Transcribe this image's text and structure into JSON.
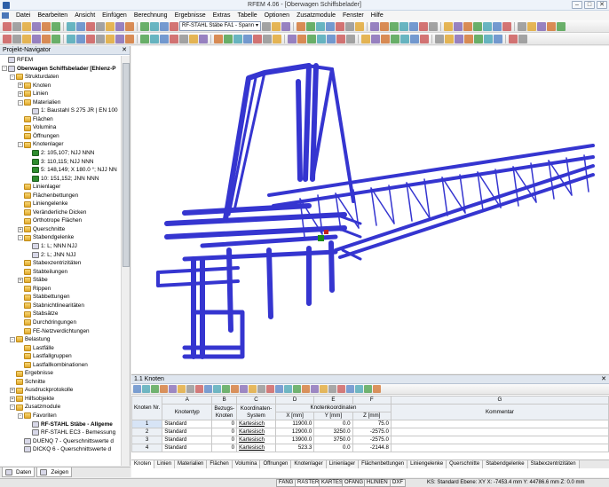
{
  "window": {
    "title": "RFEM 4.06 - [Oberwagen Schiffsbelader]"
  },
  "menu": [
    "Datei",
    "Bearbeiten",
    "Ansicht",
    "Einfügen",
    "Berechnung",
    "Ergebnisse",
    "Extras",
    "Tabelle",
    "Optionen",
    "Zusatzmodule",
    "Fenster",
    "Hilfe"
  ],
  "toolbar": {
    "module_combo": "RF-STAHL Stäbe FA1 - Spann"
  },
  "navigator": {
    "title": "Projekt-Navigator",
    "tree": [
      {
        "label": "RFEM",
        "level": 0,
        "exp": "",
        "icon": "itemico"
      },
      {
        "label": "Oberwagen Schiffsbelader [Ehlenz-P",
        "level": 0,
        "exp": "-",
        "icon": "itemico",
        "bold": true
      },
      {
        "label": "Strukturdaten",
        "level": 1,
        "exp": "-",
        "icon": "folder"
      },
      {
        "label": "Knoten",
        "level": 2,
        "exp": "+",
        "icon": "folder"
      },
      {
        "label": "Linien",
        "level": 2,
        "exp": "+",
        "icon": "folder"
      },
      {
        "label": "Materialien",
        "level": 2,
        "exp": "-",
        "icon": "folder"
      },
      {
        "label": "1: Baustahl S 275 JR | EN 100",
        "level": 3,
        "exp": "",
        "icon": "itemico"
      },
      {
        "label": "Flächen",
        "level": 2,
        "exp": "",
        "icon": "folder"
      },
      {
        "label": "Volumina",
        "level": 2,
        "exp": "",
        "icon": "folder"
      },
      {
        "label": "Öffnungen",
        "level": 2,
        "exp": "",
        "icon": "folder"
      },
      {
        "label": "Knotenlager",
        "level": 2,
        "exp": "-",
        "icon": "folder"
      },
      {
        "label": "2: 105,107; NJJ NNN",
        "level": 3,
        "exp": "",
        "icon": "supico"
      },
      {
        "label": "3: 110,115; NJJ NNN",
        "level": 3,
        "exp": "",
        "icon": "supico"
      },
      {
        "label": "5: 148,149; X 180.0 °; NJJ NN",
        "level": 3,
        "exp": "",
        "icon": "supico"
      },
      {
        "label": "10: 151,152; JNN NNN",
        "level": 3,
        "exp": "",
        "icon": "supico"
      },
      {
        "label": "Linienlager",
        "level": 2,
        "exp": "",
        "icon": "folder"
      },
      {
        "label": "Flächenbettungen",
        "level": 2,
        "exp": "",
        "icon": "folder"
      },
      {
        "label": "Liniengelenke",
        "level": 2,
        "exp": "",
        "icon": "folder"
      },
      {
        "label": "Veränderliche Dicken",
        "level": 2,
        "exp": "",
        "icon": "folder"
      },
      {
        "label": "Orthotrope Flächen",
        "level": 2,
        "exp": "",
        "icon": "folder"
      },
      {
        "label": "Querschnitte",
        "level": 2,
        "exp": "+",
        "icon": "folder"
      },
      {
        "label": "Stabendgelenke",
        "level": 2,
        "exp": "-",
        "icon": "folder"
      },
      {
        "label": "1: L; NNN NJJ",
        "level": 3,
        "exp": "",
        "icon": "itemico"
      },
      {
        "label": "2: L; JNN NJJ",
        "level": 3,
        "exp": "",
        "icon": "itemico"
      },
      {
        "label": "Stabexzentrizitäten",
        "level": 2,
        "exp": "",
        "icon": "folder"
      },
      {
        "label": "Stabteilungen",
        "level": 2,
        "exp": "",
        "icon": "folder"
      },
      {
        "label": "Stäbe",
        "level": 2,
        "exp": "+",
        "icon": "folder"
      },
      {
        "label": "Rippen",
        "level": 2,
        "exp": "",
        "icon": "folder"
      },
      {
        "label": "Stabbettungen",
        "level": 2,
        "exp": "",
        "icon": "folder"
      },
      {
        "label": "Stabnichtlinearitäten",
        "level": 2,
        "exp": "",
        "icon": "folder"
      },
      {
        "label": "Stabsätze",
        "level": 2,
        "exp": "",
        "icon": "folder"
      },
      {
        "label": "Durchdringungen",
        "level": 2,
        "exp": "",
        "icon": "folder"
      },
      {
        "label": "FE-Netzverdichtungen",
        "level": 2,
        "exp": "",
        "icon": "folder"
      },
      {
        "label": "Belastung",
        "level": 1,
        "exp": "-",
        "icon": "folder"
      },
      {
        "label": "Lastfälle",
        "level": 2,
        "exp": "",
        "icon": "folder"
      },
      {
        "label": "Lastfallgruppen",
        "level": 2,
        "exp": "",
        "icon": "folder"
      },
      {
        "label": "Lastfallkombinationen",
        "level": 2,
        "exp": "",
        "icon": "folder"
      },
      {
        "label": "Ergebnisse",
        "level": 1,
        "exp": "",
        "icon": "folder"
      },
      {
        "label": "Schnitte",
        "level": 1,
        "exp": "",
        "icon": "folder"
      },
      {
        "label": "Ausdruckprotokolle",
        "level": 1,
        "exp": "+",
        "icon": "folder"
      },
      {
        "label": "Hilfsobjekte",
        "level": 1,
        "exp": "+",
        "icon": "folder"
      },
      {
        "label": "Zusatzmodule",
        "level": 1,
        "exp": "-",
        "icon": "folder"
      },
      {
        "label": "Favoriten",
        "level": 2,
        "exp": "-",
        "icon": "folder"
      },
      {
        "label": "RF-STAHL Stäbe - Allgeme",
        "level": 3,
        "exp": "",
        "icon": "itemico",
        "bold": true
      },
      {
        "label": "RF-STAHL EC3 - Bemessung",
        "level": 3,
        "exp": "",
        "icon": "itemico"
      },
      {
        "label": "DUENQ 7 - Querschnittswerte d",
        "level": 2,
        "exp": "",
        "icon": "itemico"
      },
      {
        "label": "DICKQ 6 - Querschnittswerte d",
        "level": 2,
        "exp": "",
        "icon": "itemico"
      }
    ],
    "tabs": [
      "Daten",
      "Zeigen"
    ]
  },
  "table": {
    "title": "1.1 Knoten",
    "col_letters": [
      "A",
      "B",
      "C",
      "D",
      "E",
      "F",
      "G"
    ],
    "row_header": "Knoten Nr.",
    "headers": {
      "knotentyp": "Knotentyp",
      "bezugsknoten": "Bezugs-Knoten",
      "koordsystem": "Koordinaten-System",
      "koordgroup": "Knotenkoordinaten",
      "x": "X [mm]",
      "y": "Y [mm]",
      "z": "Z [mm]",
      "kommentar": "Kommentar"
    },
    "rows": [
      {
        "nr": "1",
        "typ": "Standard",
        "bezug": "0",
        "system": "Kartesisch",
        "x": "11900.0",
        "y": "0.0",
        "z": "75.0"
      },
      {
        "nr": "2",
        "typ": "Standard",
        "bezug": "0",
        "system": "Kartesisch",
        "x": "12900.0",
        "y": "3250.0",
        "z": "-2575.0"
      },
      {
        "nr": "3",
        "typ": "Standard",
        "bezug": "0",
        "system": "Kartesisch",
        "x": "13900.0",
        "y": "3750.0",
        "z": "-2575.0"
      },
      {
        "nr": "4",
        "typ": "Standard",
        "bezug": "0",
        "system": "Kartesisch",
        "x": "523.3",
        "y": "0.0",
        "z": "-2144.8"
      }
    ],
    "sheet_tabs": [
      "Knoten",
      "Linien",
      "Materialien",
      "Flächen",
      "Volumina",
      "Öffnungen",
      "Knotenlager",
      "Linienlager",
      "Flächenbettungen",
      "Liniengelenke",
      "Querschnitte",
      "Stabendgelenke",
      "Stabexzentrizitäten"
    ]
  },
  "status": {
    "buttons": [
      "FANG",
      "RASTER",
      "KARTES",
      "OFANG",
      "HLINIEN",
      "DXF"
    ],
    "info": "KS: Standard  Ebene: XY  X: -7453.4 mm Y:  44786.6 mm Z:  0.0 mm"
  },
  "colors": {
    "structure": "#3333cc",
    "structure_dark": "#1a1a99"
  }
}
